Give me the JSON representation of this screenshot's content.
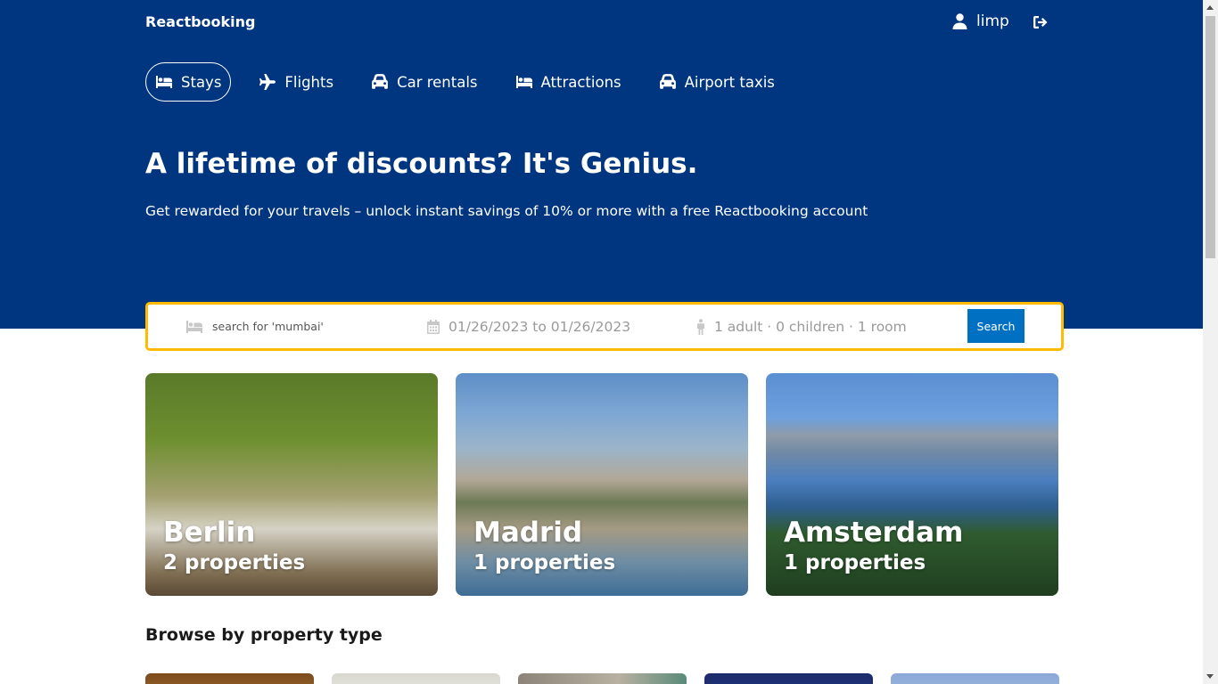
{
  "header": {
    "logo": "Reactbooking",
    "user_name": "limp",
    "user_icon": "user-icon",
    "logout_icon": "sign-out-icon"
  },
  "nav": {
    "items": [
      {
        "label": "Stays",
        "icon": "bed-icon",
        "active": true
      },
      {
        "label": "Flights",
        "icon": "plane-icon",
        "active": false
      },
      {
        "label": "Car rentals",
        "icon": "car-icon",
        "active": false
      },
      {
        "label": "Attractions",
        "icon": "bed-icon",
        "active": false
      },
      {
        "label": "Airport taxis",
        "icon": "taxi-icon",
        "active": false
      }
    ]
  },
  "hero": {
    "headline": "A lifetime of discounts? It's Genius.",
    "subline": "Get rewarded for your travels – unlock instant savings of 10% or more with a free Reactbooking account"
  },
  "search": {
    "destination_placeholder": "search for 'mumbai'",
    "date_range": "01/26/2023 to 01/26/2023",
    "guests": "1 adult · 0 children · 1 room",
    "button_label": "Search"
  },
  "featured": [
    {
      "city": "Berlin",
      "properties": "2 properties"
    },
    {
      "city": "Madrid",
      "properties": "1 properties"
    },
    {
      "city": "Amsterdam",
      "properties": "1 properties"
    }
  ],
  "browse": {
    "title": "Browse by property type"
  },
  "colors": {
    "brand_blue": "#003580",
    "search_border": "#febb02",
    "button_blue": "#0071c2"
  }
}
